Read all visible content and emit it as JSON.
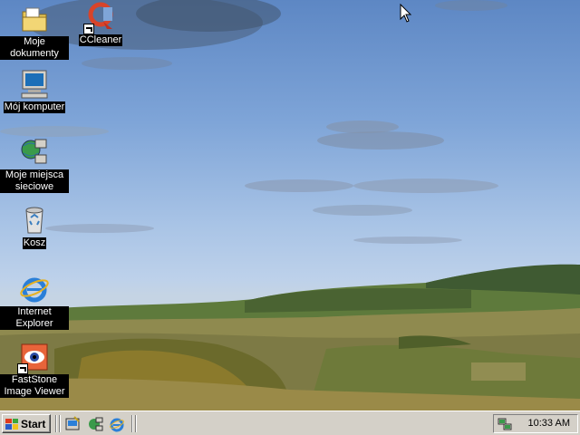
{
  "desktop": {
    "icons": [
      {
        "label": "Moje dokumenty",
        "icon": "folder-documents-icon"
      },
      {
        "label": "CCleaner",
        "icon": "ccleaner-icon"
      },
      {
        "label": "Mój komputer",
        "icon": "computer-icon"
      },
      {
        "label": "Moje miejsca sieciowe",
        "icon": "network-places-icon"
      },
      {
        "label": "Kosz",
        "icon": "recycle-bin-icon"
      },
      {
        "label": "Internet Explorer",
        "icon": "internet-explorer-icon"
      },
      {
        "label": "FastStone Image Viewer",
        "icon": "faststone-icon"
      }
    ],
    "wallpaper": "hills landscape with blue sky"
  },
  "taskbar": {
    "start_label": "Start",
    "quick_launch": [
      "show-desktop-icon",
      "network-icon",
      "internet-explorer-icon"
    ],
    "clock": "10:33 AM",
    "tray_icons": [
      "network-connection-icon"
    ]
  },
  "colors": {
    "taskbar": "#d4d0c8",
    "label_bg": "#000000",
    "sky": "#7fa5d8"
  }
}
